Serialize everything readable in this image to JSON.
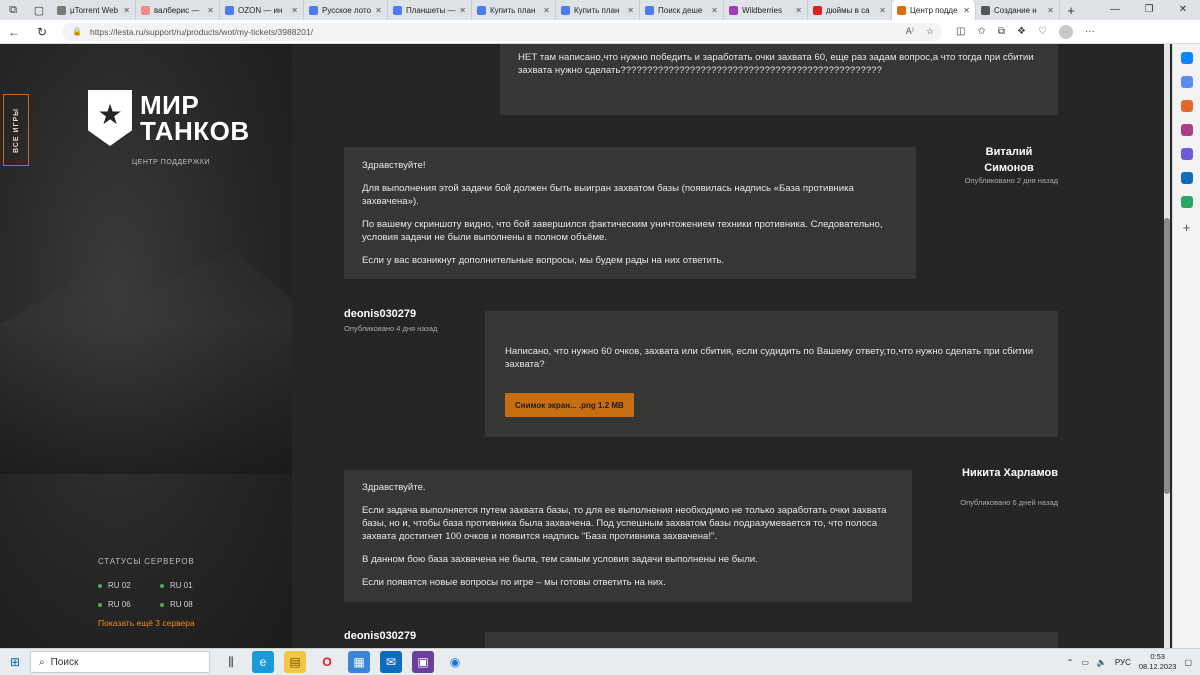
{
  "browser": {
    "tabs": [
      {
        "label": "µTorrent Web",
        "color": "#7a7a7a"
      },
      {
        "label": "валберис —",
        "color": "#f58b8b"
      },
      {
        "label": "OZON — ин",
        "color": "#4b7cf0"
      },
      {
        "label": "Русское лото",
        "color": "#4b7cf0"
      },
      {
        "label": "Планшеты —",
        "color": "#4b7cf0"
      },
      {
        "label": "Купить план",
        "color": "#4b7cf0"
      },
      {
        "label": "Купить план",
        "color": "#4b7cf0"
      },
      {
        "label": "Поиск деше",
        "color": "#4b7cf0"
      },
      {
        "label": "Wildberries",
        "color": "#a23bb8"
      },
      {
        "label": "дюймы в са",
        "color": "#e02020"
      },
      {
        "label": "Центр подде",
        "color": "#e06a10",
        "active": true
      },
      {
        "label": "Создание н",
        "color": "#555555"
      }
    ],
    "new_tab": "+",
    "url": "https://lesta.ru/support/ru/products/wot/my-tickets/3988201/"
  },
  "sidebar": {
    "all_games": "ВСЕ ИГРЫ",
    "logo_line1": "МИР",
    "logo_line2": "ТАНКОВ",
    "support": "ЦЕНТР ПОДДЕРЖКИ",
    "servers_title": "СТАТУСЫ СЕРВЕРОВ",
    "servers": [
      "RU 02",
      "RU 01",
      "RU 06",
      "RU 08"
    ],
    "more": "Показать ещё 3 сервера"
  },
  "messages": {
    "m0": {
      "text": "НЕТ там написано,что нужно победить и заработать очки захвата 60, еще раз задам вопрос,а что тогда при сбитии захвата нужно сделать?????????????????????????????????????????????????"
    },
    "m1": {
      "author": "Виталий Симонов",
      "published": "Опубликовано 2 дня назад",
      "p1": "Здравствуйте!",
      "p2": "Для выполнения этой задачи бой должен быть выигран захватом базы (появилась надпись «База противника захвачена»).",
      "p3": "По вашему скриншоту видно, что бой завершился фактическим уничтожением техники противника. Следовательно, условия задачи не были выполнены в полном объёме.",
      "p4": "Если у вас возникнут дополнительные вопросы, мы будем рады на них ответить."
    },
    "m2": {
      "author": "deonis030279",
      "published": "Опубликовано 4 дня назад",
      "p1": "Написано, что нужно 60 очков, захвата или сбития, если судидить по Вашему ответу,то,что нужно сделать при сбитии захвата?",
      "attachment": "Снимок экран... .png  1.2 MB"
    },
    "m3": {
      "author": "Никита Харламов",
      "published": "Опубликовано 6 дней назад",
      "p1": "Здравствуйте.",
      "p2": "Если задача выполняется путем захвата базы, то для ее выполнения необходимо не только заработать очки захвата базы, но и, чтобы база противника была захвачена. Под успешным захватом базы подразумевается то, что полоса захвата достигнет 100 очков и появится надпись \"База противника захвачена!\".",
      "p3": "В данном бою база захвачена не была, тем самым условия задачи выполнены не были.",
      "p4": "Если появятся новые вопросы по игре – мы готовы ответить на них."
    },
    "m4": {
      "author": "deonis030279"
    }
  },
  "taskbar": {
    "search": "Поиск",
    "lang": "РУС",
    "time": "0:53",
    "date": "08.12.2023"
  }
}
